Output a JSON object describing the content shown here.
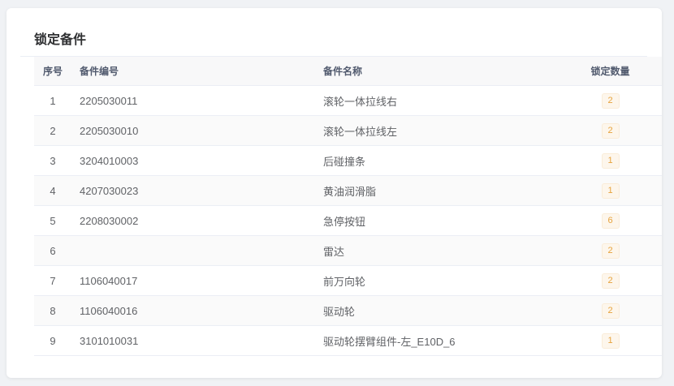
{
  "card": {
    "title": "锁定备件"
  },
  "table": {
    "headers": {
      "index": "序号",
      "code": "备件编号",
      "name": "备件名称",
      "qty": "锁定数量"
    },
    "rows": [
      {
        "index": "1",
        "code": "2205030011",
        "name": "滚轮一体拉线右",
        "qty": "2"
      },
      {
        "index": "2",
        "code": "2205030010",
        "name": "滚轮一体拉线左",
        "qty": "2"
      },
      {
        "index": "3",
        "code": "3204010003",
        "name": "后碰撞条",
        "qty": "1"
      },
      {
        "index": "4",
        "code": "4207030023",
        "name": "黄油润滑脂",
        "qty": "1"
      },
      {
        "index": "5",
        "code": "2208030002",
        "name": "急停按钮",
        "qty": "6"
      },
      {
        "index": "6",
        "code": "",
        "name": "雷达",
        "qty": "2"
      },
      {
        "index": "7",
        "code": "1106040017",
        "name": "前万向轮",
        "qty": "2"
      },
      {
        "index": "8",
        "code": "1106040016",
        "name": "驱动轮",
        "qty": "2"
      },
      {
        "index": "9",
        "code": "3101010031",
        "name": "驱动轮摆臂组件-左_E10D_6",
        "qty": "1"
      }
    ]
  },
  "colors": {
    "badge_text": "#e6a23c",
    "badge_bg": "#fdf6ec",
    "header_bg": "#f8f8f9"
  }
}
